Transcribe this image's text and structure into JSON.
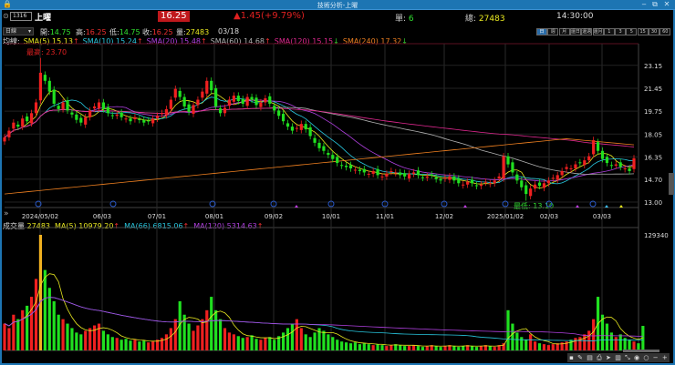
{
  "window": {
    "title": "技術分析-上曜",
    "min": "‒",
    "restore": "⧉",
    "close": "✕"
  },
  "header": {
    "code": "1316",
    "name": "上曜",
    "price": "16.25",
    "change": "▲1.45(+9.79%)",
    "single_label": "單:",
    "single_value": "6",
    "total_label": "總:",
    "total_value": "27483",
    "time": "14:30:00"
  },
  "ohlc": {
    "period": "日線",
    "open_label": "開:",
    "open": "14.75",
    "high_label": "高:",
    "high": "16.25",
    "low_label": "低:",
    "low": "14.75",
    "close_label": "收:",
    "close": "16.25",
    "vol_label": "量:",
    "vol": "27483",
    "date": "03/18"
  },
  "periods": [
    "日",
    "週",
    "月",
    "還日",
    "還週",
    "還月",
    "1",
    "3",
    "5",
    "15",
    "30",
    "60"
  ],
  "ma_legend": {
    "label": "均線:",
    "items": [
      {
        "text": "SMA(5) 15.13",
        "arrow": "↑",
        "color": "#e8e820",
        "arrow_color": "#f03030"
      },
      {
        "text": "SMA(10) 15.24",
        "arrow": "↑",
        "color": "#28c8e0",
        "arrow_color": "#f03030"
      },
      {
        "text": "SMA(20) 15.48",
        "arrow": "↑",
        "color": "#b040e0",
        "arrow_color": "#f03030"
      },
      {
        "text": "SMA(60) 14.68",
        "arrow": "↑",
        "color": "#b0b0b0",
        "arrow_color": "#f03030"
      },
      {
        "text": "SMA(120) 15.15",
        "arrow": "↓",
        "color": "#e02890",
        "arrow_color": "#30d030"
      },
      {
        "text": "SMA(240) 17.32",
        "arrow": "↓",
        "color": "#f08020",
        "arrow_color": "#30d030"
      }
    ]
  },
  "vol_legend": {
    "label": "成交量",
    "value": "27483",
    "items": [
      {
        "text": "MA(5) 10979.20",
        "arrow": "↑",
        "color": "#e8e820"
      },
      {
        "text": "MA(66) 6815.06",
        "arrow": "↑",
        "color": "#28c8e0"
      },
      {
        "text": "MA(120) 5314.63",
        "arrow": "↑",
        "color": "#b040e0"
      }
    ]
  },
  "max_label": "最高: 23.70",
  "min_label": "最低: 13.10",
  "y_ticks": [
    "23.15",
    "21.45",
    "19.75",
    "18.05",
    "16.35",
    "14.70",
    "13.00"
  ],
  "vol_tick": "129340",
  "x_ticks": [
    "2024/05/02",
    "06/03",
    "07/01",
    "08/01",
    "09/02",
    "10/01",
    "11/01",
    "12/02",
    "2025/01/02",
    "02/03",
    "03/03"
  ],
  "toolbar": [
    "▪",
    "✎",
    "▤",
    "⎙",
    "➤",
    "▥",
    "⤡",
    "◉",
    "○",
    "−",
    "+"
  ],
  "chart_data": {
    "type": "candlestick",
    "closes": [
      17.8,
      18.3,
      18.9,
      18.6,
      19.2,
      19.0,
      19.6,
      20.4,
      22.6,
      22.0,
      21.2,
      20.3,
      19.9,
      20.4,
      19.8,
      19.5,
      19.1,
      18.9,
      19.3,
      19.8,
      20.1,
      20.4,
      19.9,
      19.6,
      19.4,
      19.5,
      19.3,
      19.2,
      19.0,
      19.3,
      19.1,
      18.9,
      19.0,
      19.2,
      19.4,
      19.6,
      19.9,
      20.6,
      21.4,
      20.8,
      20.1,
      19.7,
      20.2,
      20.6,
      21.2,
      22.0,
      21.3,
      20.1,
      19.6,
      20.0,
      20.6,
      20.9,
      20.5,
      20.3,
      20.8,
      20.6,
      20.2,
      20.4,
      20.7,
      20.3,
      19.8,
      19.4,
      19.0,
      18.6,
      18.3,
      18.5,
      18.8,
      18.4,
      17.9,
      17.4,
      17.0,
      16.8,
      16.5,
      16.2,
      15.9,
      15.7,
      15.6,
      15.5,
      15.4,
      15.3,
      15.2,
      15.1,
      15.3,
      15.0,
      14.9,
      15.1,
      15.3,
      15.2,
      15.0,
      14.9,
      15.1,
      15.2,
      15.0,
      14.8,
      14.9,
      15.0,
      14.7,
      14.6,
      14.8,
      14.9,
      14.6,
      14.4,
      14.3,
      14.5,
      14.4,
      14.2,
      14.3,
      14.5,
      14.4,
      14.6,
      14.9,
      16.4,
      15.8,
      15.2,
      14.6,
      14.1,
      13.6,
      14.0,
      14.3,
      14.2,
      14.4,
      14.6,
      14.8,
      15.0,
      15.3,
      15.6,
      15.5,
      15.8,
      15.9,
      16.1,
      16.4,
      17.6,
      16.8,
      16.2,
      15.9,
      15.7,
      15.8,
      15.6,
      15.5,
      15.3,
      16.25
    ],
    "volumes": [
      30000,
      25000,
      40000,
      35000,
      45000,
      50000,
      60000,
      80000,
      129340,
      90000,
      70000,
      55000,
      40000,
      35000,
      30000,
      25000,
      20000,
      18000,
      22000,
      25000,
      28000,
      30000,
      22000,
      18000,
      15000,
      14000,
      12000,
      13000,
      11000,
      12000,
      10000,
      11000,
      9000,
      10000,
      12000,
      14000,
      18000,
      25000,
      35000,
      55000,
      40000,
      30000,
      22000,
      28000,
      35000,
      45000,
      60000,
      45000,
      35000,
      25000,
      20000,
      18000,
      16000,
      14000,
      15000,
      17000,
      13000,
      12000,
      14000,
      15000,
      12000,
      16000,
      20000,
      25000,
      30000,
      35000,
      25000,
      18000,
      15000,
      20000,
      25000,
      22000,
      18000,
      15000,
      12000,
      10000,
      9000,
      8000,
      9000,
      7000,
      8000,
      7000,
      6000,
      7000,
      6000,
      5000,
      6000,
      7000,
      6000,
      5000,
      5000,
      6000,
      5000,
      4000,
      5000,
      6000,
      5000,
      4000,
      5000,
      6000,
      5000,
      4000,
      5000,
      6000,
      5000,
      4000,
      5000,
      6000,
      5000,
      4000,
      6000,
      8000,
      45000,
      30000,
      20000,
      15000,
      12000,
      18000,
      10000,
      8000,
      7000,
      6000,
      7000,
      8000,
      9000,
      10000,
      12000,
      14000,
      15000,
      18000,
      22000,
      35000,
      60000,
      40000,
      30000,
      20000,
      15000,
      18000,
      14000,
      12000,
      10000,
      8000,
      27483
    ],
    "high": 23.7,
    "low": 13.1,
    "ylim": [
      13.0,
      23.15
    ],
    "vol_max": 129340
  }
}
